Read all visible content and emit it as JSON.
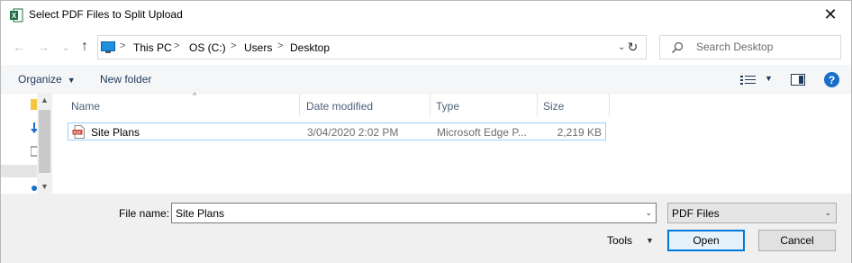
{
  "window": {
    "title": "Select PDF Files to Split Upload",
    "close_glyph": "✕"
  },
  "nav": {
    "back_glyph": "←",
    "forward_glyph": "→",
    "recent_glyph": "⌄",
    "up_glyph": "↑",
    "breadcrumbs": [
      "This PC",
      "OS (C:)",
      "Users",
      "Desktop"
    ],
    "separator": ">",
    "dropdown_glyph": "⌄",
    "refresh_glyph": "↻",
    "search_placeholder": "Search Desktop"
  },
  "toolbar": {
    "organize_label": "Organize",
    "new_folder_label": "New folder",
    "caret_glyph": "▼",
    "help_glyph": "?"
  },
  "columns": {
    "name": "Name",
    "date": "Date modified",
    "type": "Type",
    "size": "Size",
    "sort_glyph": "^"
  },
  "files": [
    {
      "name": "Site Plans",
      "date": "3/04/2020 2:02 PM",
      "type": "Microsoft Edge P...",
      "size": "2,219 KB",
      "icon": "pdf-icon"
    }
  ],
  "bottom": {
    "file_name_label": "File name:",
    "file_name_value": "Site Plans",
    "file_type_value": "PDF Files",
    "tools_label": "Tools",
    "open_label": "Open",
    "cancel_label": "Cancel",
    "caret_glyph": "▼",
    "dropdown_glyph": "⌄"
  },
  "colors": {
    "accent": "#0078d7",
    "selection_border": "#99d1ff",
    "toolbar_text": "#1e395b",
    "excel_green": "#1d6f42",
    "pdf_red": "#c0392b"
  }
}
